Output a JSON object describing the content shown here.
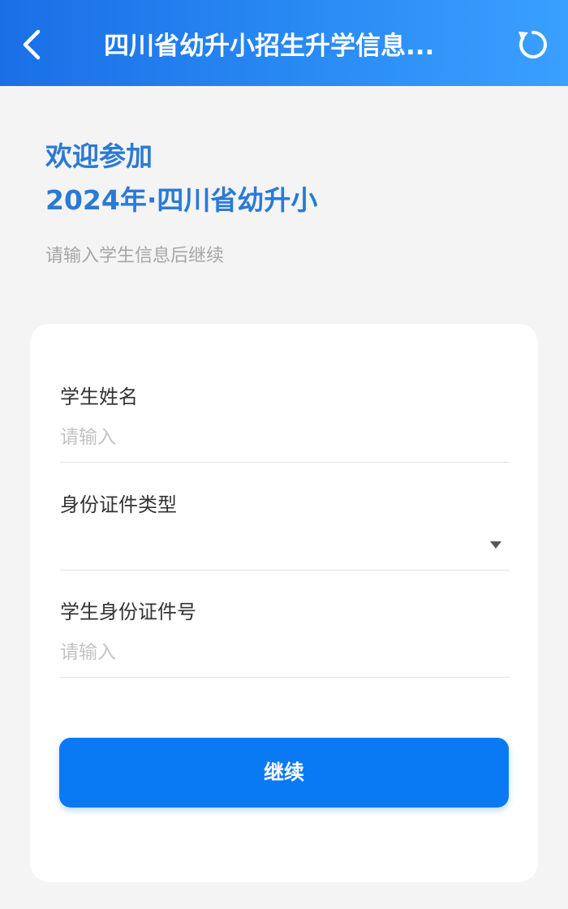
{
  "header": {
    "title": "四川省幼升小招生升学信息...",
    "back_icon": "chevron-left-icon",
    "refresh_icon": "refresh-icon",
    "background": "#2b8df5"
  },
  "welcome": {
    "line1": "欢迎参加",
    "line2": "2024年·四川省幼升小",
    "color": "#2a7ad6"
  },
  "subtitle": "请输入学生信息后继续",
  "form": {
    "student_name": {
      "label": "学生姓名",
      "placeholder": "请输入",
      "value": ""
    },
    "id_type": {
      "label": "身份证件类型",
      "value": "",
      "arrow_icon": "dropdown-arrow-icon"
    },
    "id_number": {
      "label": "学生身份证件号",
      "placeholder": "请输入",
      "value": ""
    },
    "continue_label": "继续",
    "button_color": "#0a7af4"
  }
}
